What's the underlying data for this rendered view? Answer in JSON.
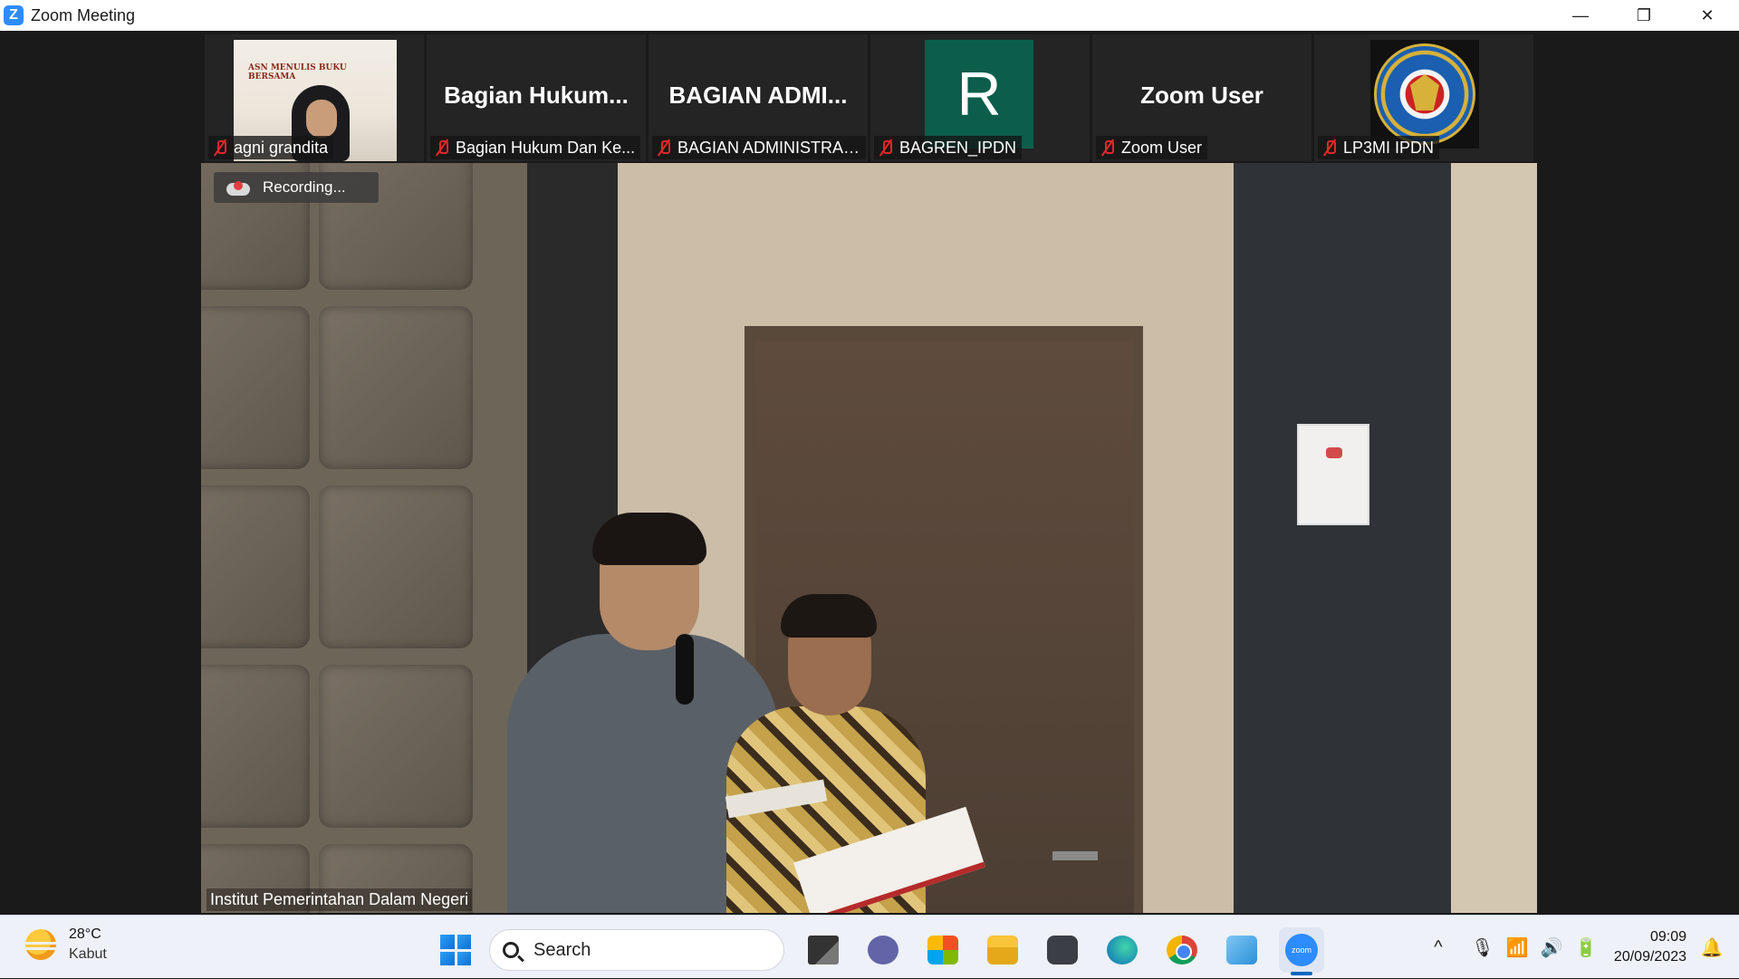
{
  "window": {
    "title": "Zoom Meeting",
    "logo_letter": "Z",
    "controls": {
      "minimize": "—",
      "restore": "❐",
      "close": "✕"
    }
  },
  "gallery": [
    {
      "label": "agni grandita",
      "type": "photo",
      "banner": "ASN MENULIS BUKU BERSAMA"
    },
    {
      "label": "Bagian Hukum Dan Ke...",
      "type": "name",
      "display_name": "Bagian  Hukum..."
    },
    {
      "label": "BAGIAN ADMINISTRAS...",
      "type": "name",
      "display_name": "BAGIAN  ADMI..."
    },
    {
      "label": "BAGREN_IPDN",
      "type": "avatar",
      "avatar_letter": "R"
    },
    {
      "label": "Zoom User",
      "type": "name",
      "display_name": "Zoom User"
    },
    {
      "label": "LP3MI IPDN",
      "type": "logo"
    }
  ],
  "main_video": {
    "recording_label": "Recording...",
    "caption": "Institut Pemerintahan Dalam Negeri"
  },
  "taskbar": {
    "weather": {
      "temp": "28°C",
      "desc": "Kabut"
    },
    "search_placeholder": "Search",
    "apps": [
      "task-view",
      "teams",
      "store",
      "file-explorer",
      "camera",
      "edge",
      "chrome",
      "photos",
      "zoom"
    ],
    "zoom_label": "zoom",
    "clock": {
      "time": "09:09",
      "date": "20/09/2023"
    },
    "tray": {
      "chevron": "^",
      "mic": "🎙",
      "wifi": "📶",
      "volume": "🔊",
      "battery": "🔋",
      "notification": "🔔"
    }
  }
}
